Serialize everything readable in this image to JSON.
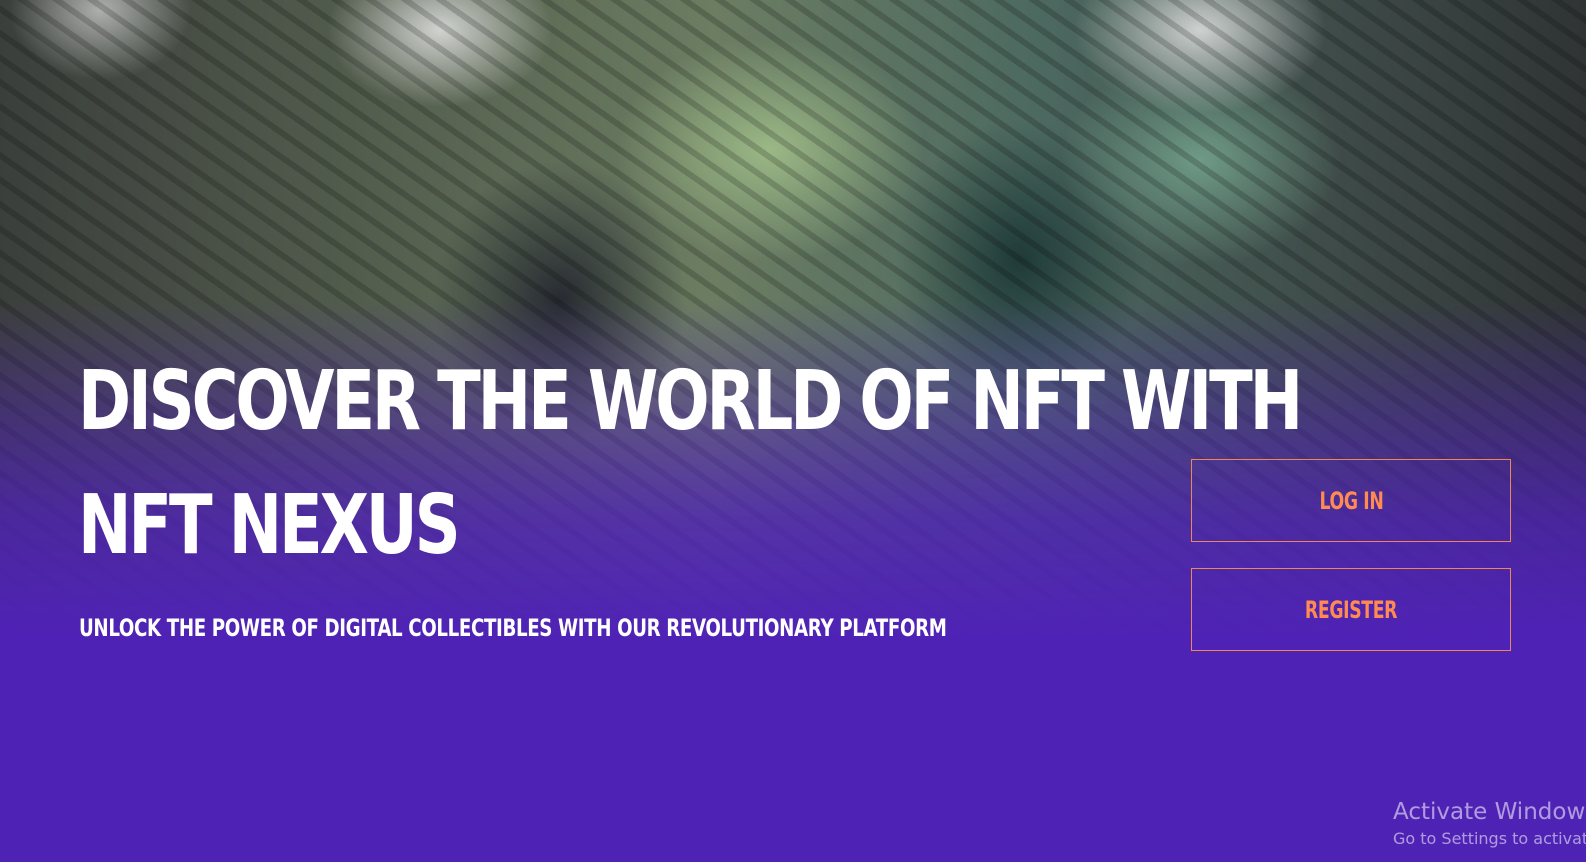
{
  "hero": {
    "headline_line1": "DISCOVER THE WORLD OF NFT WITH",
    "headline_line2": "NFT NEXUS",
    "subtitle": "UNLOCK THE POWER OF DIGITAL COLLECTIBLES WITH OUR REVOLUTIONARY PLATFORM"
  },
  "auth": {
    "login_label": "LOG IN",
    "register_label": "REGISTER"
  },
  "watermark": {
    "title": "Activate Windows",
    "subtitle": "Go to Settings to activate Windows."
  },
  "colors": {
    "background": "#4f22b6",
    "accent": "#ff8a52",
    "text": "#ffffff"
  }
}
